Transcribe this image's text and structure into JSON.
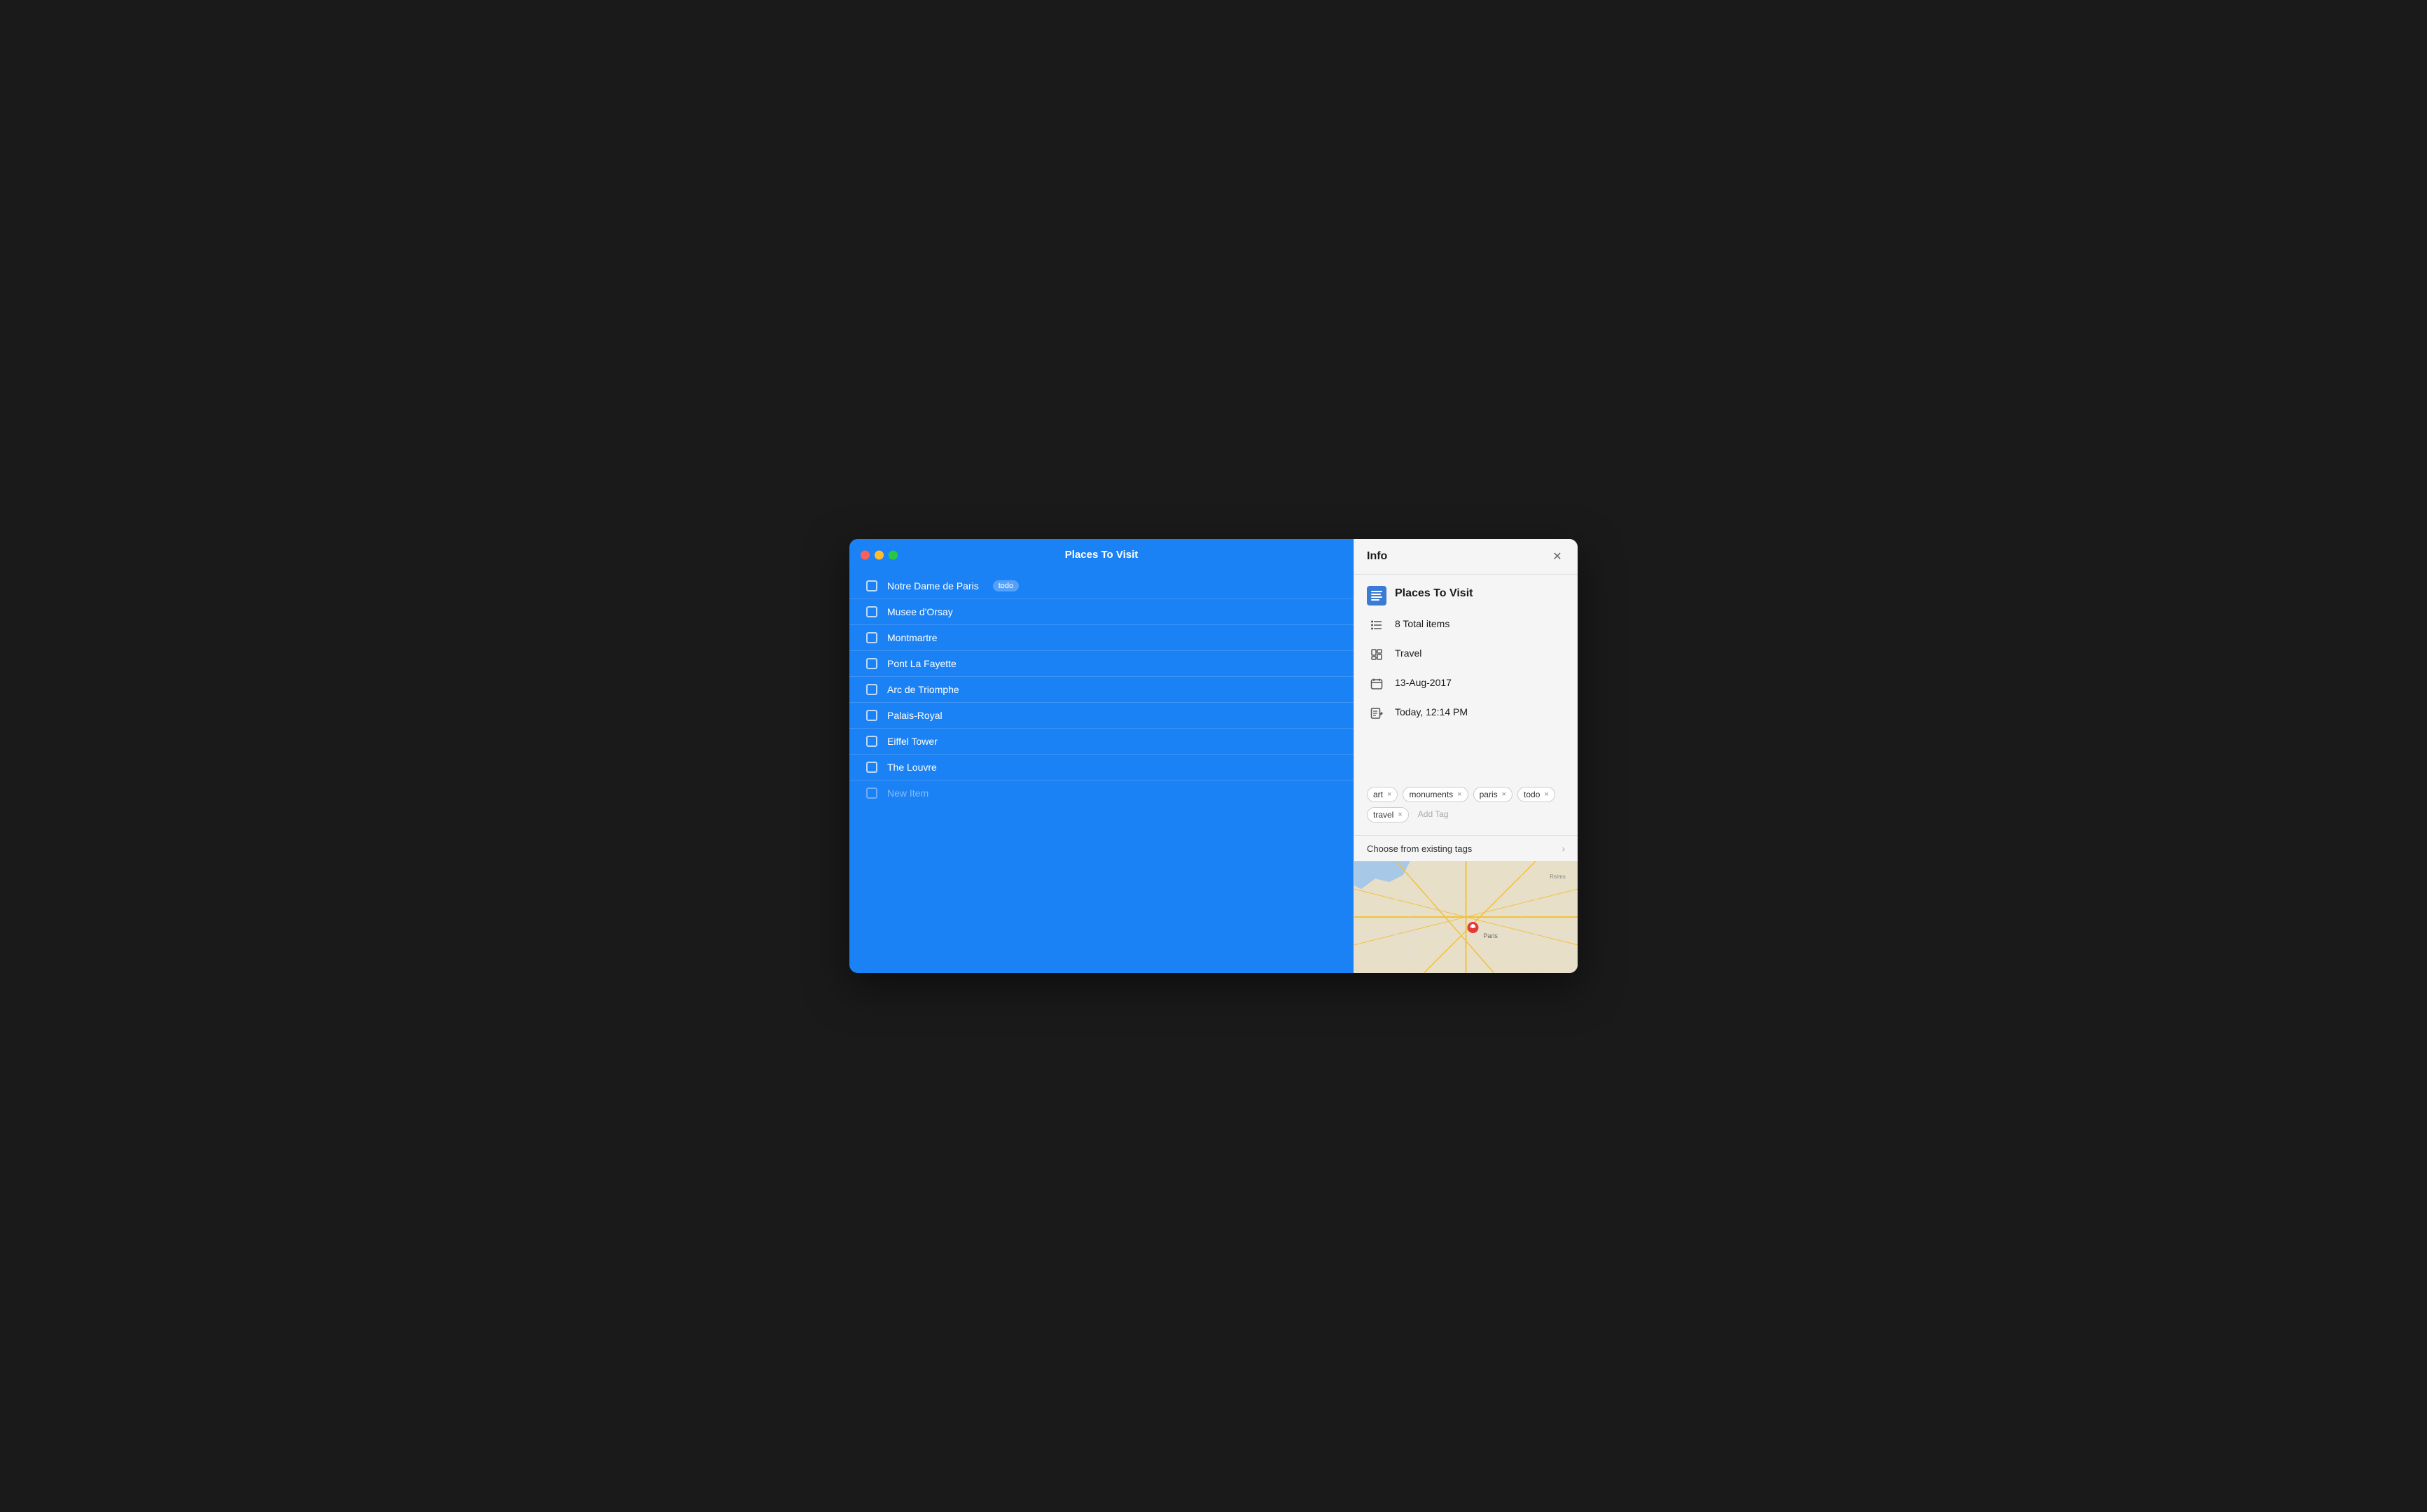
{
  "window": {
    "title": "Places To Visit"
  },
  "traffic_lights": {
    "red_label": "close",
    "yellow_label": "minimize",
    "green_label": "maximize"
  },
  "list": {
    "items": [
      {
        "id": 1,
        "text": "Notre Dame de Paris",
        "tag": "todo",
        "checked": false
      },
      {
        "id": 2,
        "text": "Musee d'Orsay",
        "tag": null,
        "checked": false
      },
      {
        "id": 3,
        "text": "Montmartre",
        "tag": null,
        "checked": false
      },
      {
        "id": 4,
        "text": "Pont La Fayette",
        "tag": null,
        "checked": false
      },
      {
        "id": 5,
        "text": "Arc de Triomphe",
        "tag": null,
        "checked": false
      },
      {
        "id": 6,
        "text": "Palais-Royal",
        "tag": null,
        "checked": false
      },
      {
        "id": 7,
        "text": "Eiffel Tower",
        "tag": null,
        "checked": false
      },
      {
        "id": 8,
        "text": "The Louvre",
        "tag": null,
        "checked": false
      }
    ],
    "new_item_placeholder": "New Item"
  },
  "info_panel": {
    "title": "Info",
    "close_label": "✕",
    "doc_title": "Places To Visit",
    "total_items": "8 Total items",
    "category": "Travel",
    "date": "13-Aug-2017",
    "modified": "Today, 12:14 PM",
    "tags": [
      {
        "label": "art"
      },
      {
        "label": "monuments"
      },
      {
        "label": "paris"
      },
      {
        "label": "todo"
      },
      {
        "label": "travel"
      }
    ],
    "add_tag_placeholder": "Add Tag",
    "choose_tags_label": "Choose from existing tags",
    "chevron": "›"
  },
  "map": {
    "location": "Paris",
    "pin_color": "#e53935"
  }
}
